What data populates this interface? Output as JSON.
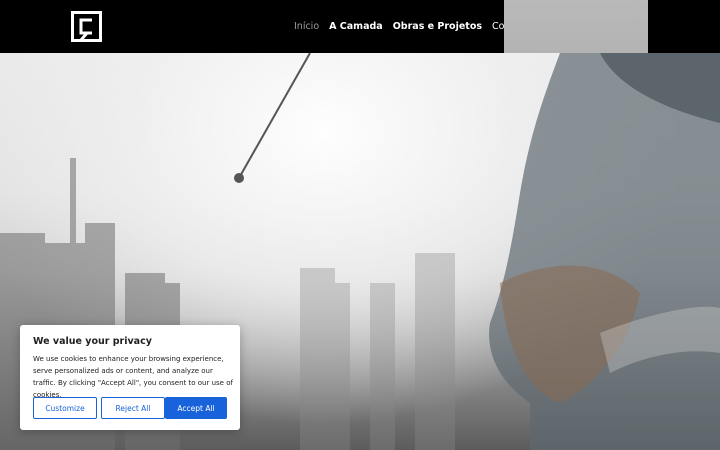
{
  "header": {
    "logo_icon": "company-logo-c-icon",
    "nav": [
      {
        "label": "Início",
        "state": "active"
      },
      {
        "label": "A Camada",
        "state": "normal"
      },
      {
        "label": "Obras e Projetos",
        "state": "normal"
      },
      {
        "label": "Contato",
        "state": "normal"
      }
    ]
  },
  "cookie_banner": {
    "title": "We value your privacy",
    "text": "We use cookies to enhance your browsing experience, serve personalized ads or content, and analyze our traffic. By clicking \"Accept All\", you consent to our use of cookies.",
    "buttons": {
      "customize": "Customize",
      "reject": "Reject All",
      "accept": "Accept All"
    },
    "accent_color": "#1863dc"
  }
}
